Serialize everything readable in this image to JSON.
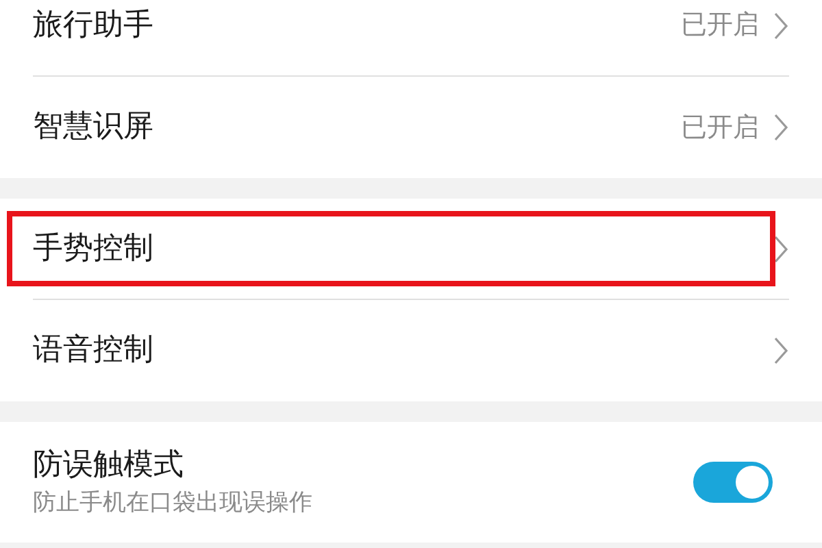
{
  "groups": [
    {
      "items": [
        {
          "kind": "link",
          "label": "旅行助手",
          "value": "已开启",
          "highlighted": false
        },
        {
          "kind": "link",
          "label": "智慧识屏",
          "value": "已开启",
          "highlighted": false
        }
      ]
    },
    {
      "items": [
        {
          "kind": "link",
          "label": "手势控制",
          "highlighted": true
        },
        {
          "kind": "link",
          "label": "语音控制",
          "highlighted": false
        }
      ]
    },
    {
      "items": [
        {
          "kind": "toggle",
          "label": "防误触模式",
          "subtitle": "防止手机在口袋出现误操作",
          "on": true,
          "highlighted": false
        }
      ]
    }
  ]
}
